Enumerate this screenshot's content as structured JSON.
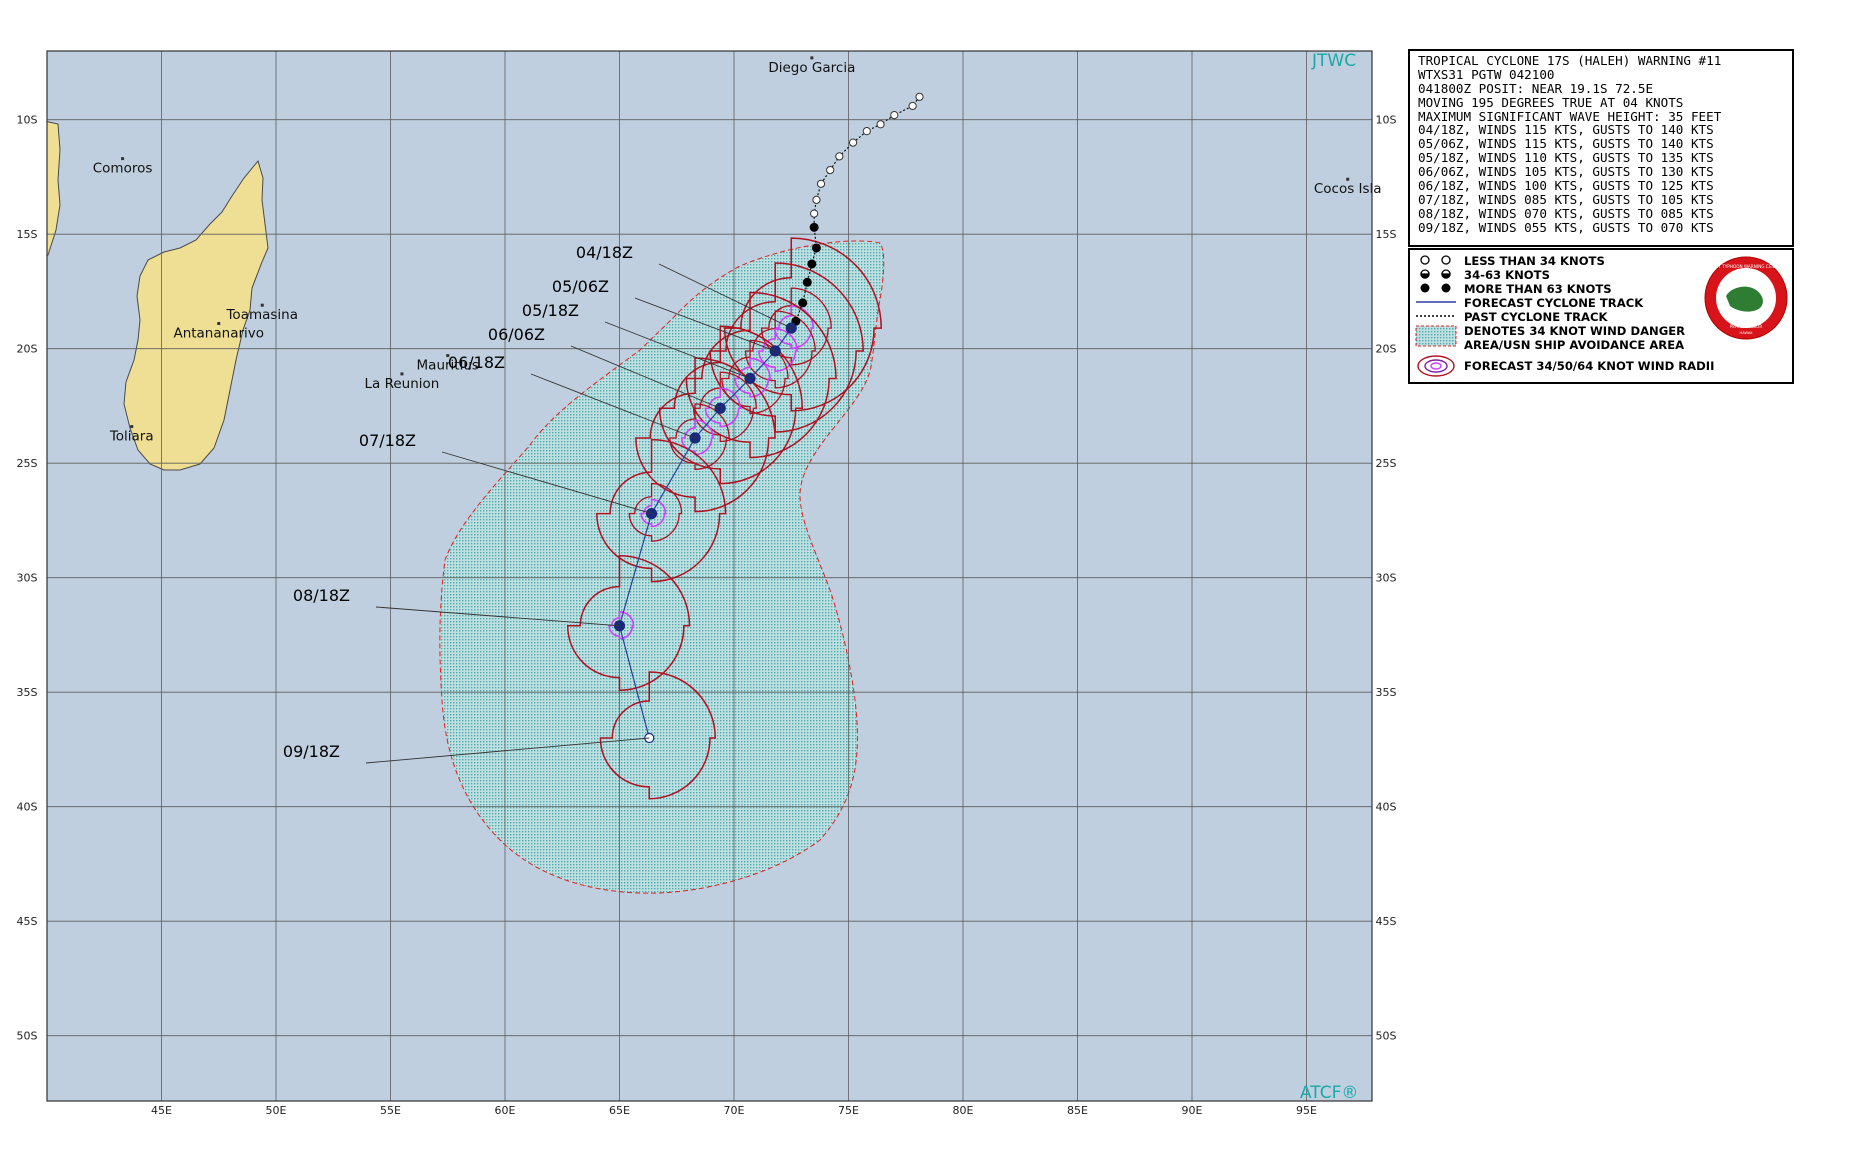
{
  "map": {
    "agency_label": "JTWC",
    "software_label": "ATCF®",
    "lon_labels": [
      "45E",
      "50E",
      "55E",
      "60E",
      "65E",
      "70E",
      "75E",
      "80E",
      "85E",
      "90E",
      "95E"
    ],
    "lat_labels": [
      "10S",
      "15S",
      "20S",
      "25S",
      "30S",
      "35S",
      "40S",
      "45S",
      "50S"
    ],
    "places": [
      {
        "name": "Diego Garcia",
        "lon": 73.4,
        "lat": 7.3
      },
      {
        "name": "Comoros",
        "lon": 43.3,
        "lat": 11.7
      },
      {
        "name": "Toamasina",
        "lon": 49.4,
        "lat": 18.1
      },
      {
        "name": "Antananarivo",
        "lon": 47.5,
        "lat": 18.9
      },
      {
        "name": "Mauritius",
        "lon": 57.5,
        "lat": 20.3
      },
      {
        "name": "La Reunion",
        "lon": 55.5,
        "lat": 21.1
      },
      {
        "name": "Toliara",
        "lon": 43.7,
        "lat": 23.4
      },
      {
        "name": "Cocos Isla",
        "lon": 96.8,
        "lat": 12.6
      }
    ],
    "forecast_points": [
      {
        "label": "04/18Z",
        "lon": 72.5,
        "lat": 19.1
      },
      {
        "label": "05/06Z",
        "lon": 71.8,
        "lat": 20.1
      },
      {
        "label": "05/18Z",
        "lon": 70.7,
        "lat": 21.3
      },
      {
        "label": "06/06Z",
        "lon": 69.4,
        "lat": 22.6
      },
      {
        "label": "06/18Z",
        "lon": 68.3,
        "lat": 23.9
      },
      {
        "label": "07/18Z",
        "lon": 66.4,
        "lat": 27.2
      },
      {
        "label": "08/18Z",
        "lon": 65.0,
        "lat": 32.1
      },
      {
        "label": "09/18Z",
        "lon": 66.3,
        "lat": 37.0
      }
    ],
    "past_track": [
      {
        "lon": 78.1,
        "lat": 9.0,
        "intensity": "lt34"
      },
      {
        "lon": 77.8,
        "lat": 9.4,
        "intensity": "lt34"
      },
      {
        "lon": 77.0,
        "lat": 9.8,
        "intensity": "lt34"
      },
      {
        "lon": 76.4,
        "lat": 10.2,
        "intensity": "lt34"
      },
      {
        "lon": 75.8,
        "lat": 10.5,
        "intensity": "lt34"
      },
      {
        "lon": 75.2,
        "lat": 11.0,
        "intensity": "lt34"
      },
      {
        "lon": 74.6,
        "lat": 11.6,
        "intensity": "lt34"
      },
      {
        "lon": 74.2,
        "lat": 12.2,
        "intensity": "lt34"
      },
      {
        "lon": 73.8,
        "lat": 12.8,
        "intensity": "lt34"
      },
      {
        "lon": 73.6,
        "lat": 13.5,
        "intensity": "lt34"
      },
      {
        "lon": 73.5,
        "lat": 14.1,
        "intensity": "lt34"
      },
      {
        "lon": 73.5,
        "lat": 14.7,
        "intensity": "gt63"
      },
      {
        "lon": 73.6,
        "lat": 15.6,
        "intensity": "gt63"
      },
      {
        "lon": 73.4,
        "lat": 16.3,
        "intensity": "gt63"
      },
      {
        "lon": 73.2,
        "lat": 17.1,
        "intensity": "gt63"
      },
      {
        "lon": 73.0,
        "lat": 18.0,
        "intensity": "gt63"
      },
      {
        "lon": 72.7,
        "lat": 18.8,
        "intensity": "gt63"
      }
    ],
    "colors": {
      "ocean": "#bfcfdf",
      "land": "#efdf95",
      "grid": "#5e5e5e",
      "danger_area": "#7cc8c8",
      "danger_border": "#e02020",
      "wind34": "#b01020",
      "wind50": "#8020a0",
      "wind64": "#d040ff",
      "track": "#2a3f9f",
      "agency_text": "#1aa8a8"
    }
  },
  "info": {
    "lines": [
      "TROPICAL CYCLONE 17S (HALEH) WARNING #11",
      "WTXS31 PGTW 042100",
      "041800Z POSIT: NEAR 19.1S 72.5E",
      "MOVING 195 DEGREES TRUE AT 04 KNOTS",
      "MAXIMUM SIGNIFICANT WAVE HEIGHT: 35 FEET",
      "04/18Z, WINDS 115 KTS, GUSTS TO 140 KTS",
      "05/06Z, WINDS 115 KTS, GUSTS TO 140 KTS",
      "05/18Z, WINDS 110 KTS, GUSTS TO 135 KTS",
      "06/06Z, WINDS 105 KTS, GUSTS TO 130 KTS",
      "06/18Z, WINDS 100 KTS, GUSTS TO 125 KTS",
      "07/18Z, WINDS 085 KTS, GUSTS TO 105 KTS",
      "08/18Z, WINDS 070 KTS, GUSTS TO 085 KTS",
      "09/18Z, WINDS 055 KTS, GUSTS TO 070 KTS"
    ]
  },
  "legend": {
    "lt34": "LESS THAN 34 KNOTS",
    "kt34_63": "34-63 KNOTS",
    "gt63": "MORE THAN 63 KNOTS",
    "forecast_track": "FORECAST CYCLONE TRACK",
    "past_track": "PAST CYCLONE TRACK",
    "danger_line1": "DENOTES 34 KNOT WIND DANGER",
    "danger_line2": "AREA/USN SHIP AVOIDANCE AREA",
    "wind_radii": "FORECAST 34/50/64 KNOT WIND RADII",
    "seal_top": "JOINT TYPHOON WARNING CENTER",
    "seal_bottom": "PEARL HARBOR",
    "seal_state": "HAWAII"
  }
}
